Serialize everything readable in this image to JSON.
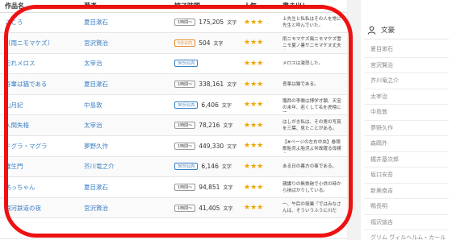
{
  "table": {
    "headers": [
      "作品名",
      "著者",
      "読了時間",
      "人気",
      "書き出し"
    ],
    "rows": [
      {
        "title": "こころ",
        "author": "夏目漱石",
        "badge": "1時間〜",
        "badge_style": "gray",
        "chars": "175,205",
        "unit": "文字",
        "stars": "★★★",
        "excerpt": "上先生と私私はその人を常に先生と呼んでいた。"
      },
      {
        "title": "〔雨ニモマケズ〕",
        "author": "宮沢賢治",
        "badge": "5分以内",
        "badge_style": "orange",
        "chars": "504",
        "unit": "文字",
        "stars": "★★★",
        "excerpt": "雨ニモマケズ風ニモマケズ雪ニモ夏ノ暑サニモマケヌ丈夫ナ..."
      },
      {
        "title": "走れメロス",
        "author": "太宰治",
        "badge": "30分以内",
        "badge_style": "blue",
        "chars": "",
        "unit": "",
        "stars": "★★★",
        "excerpt": "メロスは激怒した。"
      },
      {
        "title": "吾輩は猫である",
        "author": "夏目漱石",
        "badge": "1時間〜",
        "badge_style": "gray",
        "chars": "338,161",
        "unit": "文字",
        "stars": "★★★",
        "excerpt": "吾輩は猫である。"
      },
      {
        "title": "山月記",
        "author": "中島敦",
        "badge": "30分以内",
        "badge_style": "blue",
        "chars": "6,406",
        "unit": "文字",
        "stars": "★★★",
        "excerpt": "隴西の李徴は博学才穎、天宝の末年、若くして名を虎榜に連..."
      },
      {
        "title": "人間失格",
        "author": "太宰治",
        "badge": "1時間〜",
        "badge_style": "gray",
        "chars": "78,216",
        "unit": "文字",
        "stars": "★★★",
        "excerpt": "はしがき私は、その男の写真を三葉、見たことがある。"
      },
      {
        "title": "ドグラ・マグラ",
        "author": "夢野久作",
        "badge": "1時間〜",
        "badge_style": "gray",
        "chars": "449,330",
        "unit": "文字",
        "stars": "★★★",
        "excerpt": "【#ページの左右中央】巻頭歌胎児よ胎児よ何故躍る母親の..."
      },
      {
        "title": "羅生門",
        "author": "芥川竜之介",
        "badge": "30分以内",
        "badge_style": "blue",
        "chars": "6,146",
        "unit": "文字",
        "stars": "★★★",
        "excerpt": "ある日の暮方の事である。"
      },
      {
        "title": "坊っちゃん",
        "author": "夏目漱石",
        "badge": "1時間〜",
        "badge_style": "gray",
        "chars": "94,851",
        "unit": "文字",
        "stars": "★★★",
        "excerpt": "親譲りの無鉄砲で小供の時から損ばかりしている。"
      },
      {
        "title": "銀河鉄道の夜",
        "author": "宮沢賢治",
        "badge": "1時間〜",
        "badge_style": "gray",
        "chars": "41,405",
        "unit": "文字",
        "stars": "★★★",
        "excerpt": "一、午后の授業「ではみなさんは、そういうふうに川だと..."
      },
      {
        "title": "",
        "author": "",
        "badge": "",
        "badge_style": "gray",
        "chars": "",
        "unit": "",
        "stars": "",
        "excerpt": ""
      }
    ]
  },
  "sidebar": {
    "heading": "文豪",
    "authors": [
      "夏目漱石",
      "宮沢賢治",
      "芥川竜之介",
      "太宰治",
      "中島敦",
      "夢野久作",
      "森鴎外",
      "梶井基次郎",
      "坂口安吾",
      "新美南吉",
      "鴨長明",
      "福沢諭吉",
      "グリム ヴィルヘルム・カール"
    ]
  },
  "colors": {
    "link": "#3a7fc4",
    "star": "#f0a500",
    "highlight": "#ee1111",
    "badge_orange": "#e58b2a"
  }
}
